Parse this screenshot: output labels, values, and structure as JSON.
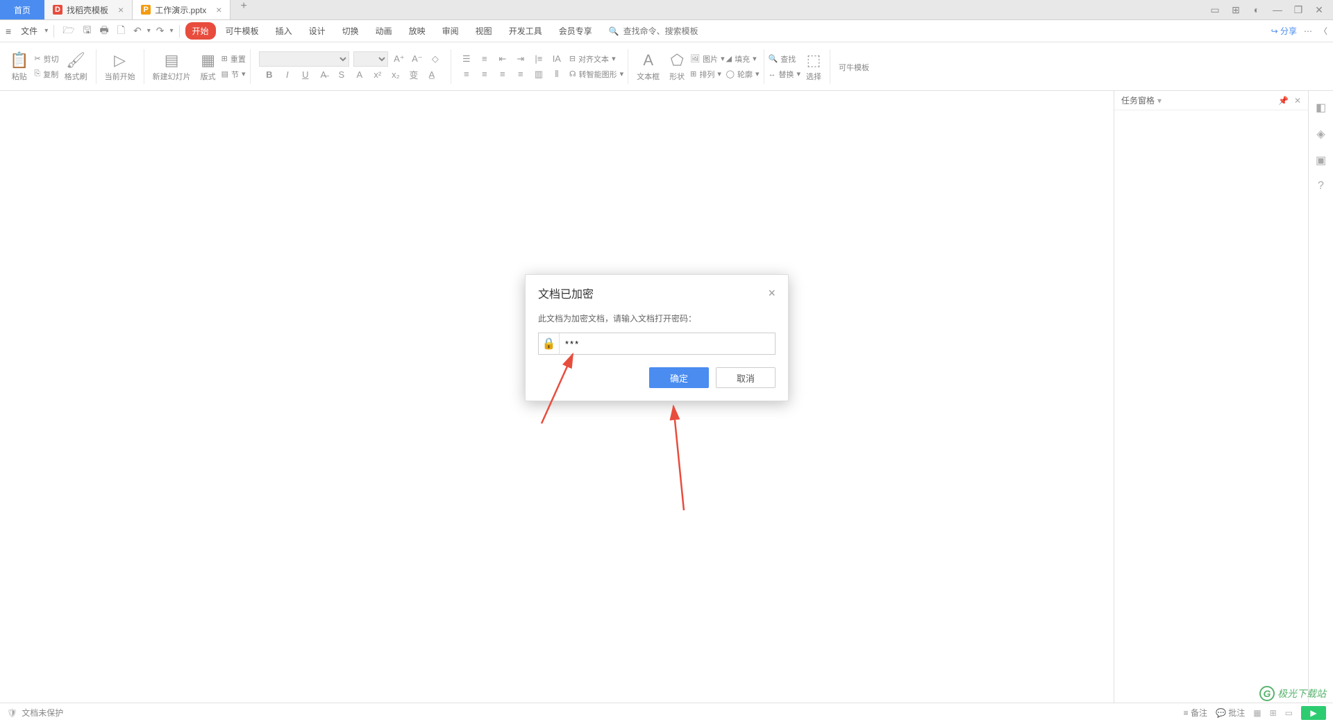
{
  "tabs": {
    "home": "首页",
    "file1": "找稻壳模板",
    "file2": "工作演示.pptx"
  },
  "menu": {
    "file": "文件",
    "items": [
      "开始",
      "可牛模板",
      "插入",
      "设计",
      "切换",
      "动画",
      "放映",
      "审阅",
      "视图",
      "开发工具",
      "会员专享"
    ],
    "search_placeholder": "查找命令、搜索模板",
    "share": "分享"
  },
  "ribbon": {
    "paste": "粘贴",
    "cut": "剪切",
    "copy": "复制",
    "format_painter": "格式刷",
    "from_begin": "当前开始",
    "new_slide": "新建幻灯片",
    "layout": "版式",
    "section": "节",
    "reset": "重置",
    "align_text": "对齐文本",
    "convert_smart": "转智能图形",
    "text_box": "文本框",
    "shape": "形状",
    "image": "图片",
    "arrange": "排列",
    "outline": "轮廓",
    "fill": "填充",
    "find": "查找",
    "replace": "替换",
    "select": "选择",
    "kn_template": "可牛模板"
  },
  "task_pane": {
    "title": "任务窗格"
  },
  "dialog": {
    "title": "文档已加密",
    "message": "此文档为加密文档，请输入文档打开密码：",
    "password_value": "***",
    "ok": "确定",
    "cancel": "取消"
  },
  "statusbar": {
    "protect": "文档未保护",
    "notes": "备注",
    "comments": "批注"
  },
  "watermark": "极光下载站"
}
